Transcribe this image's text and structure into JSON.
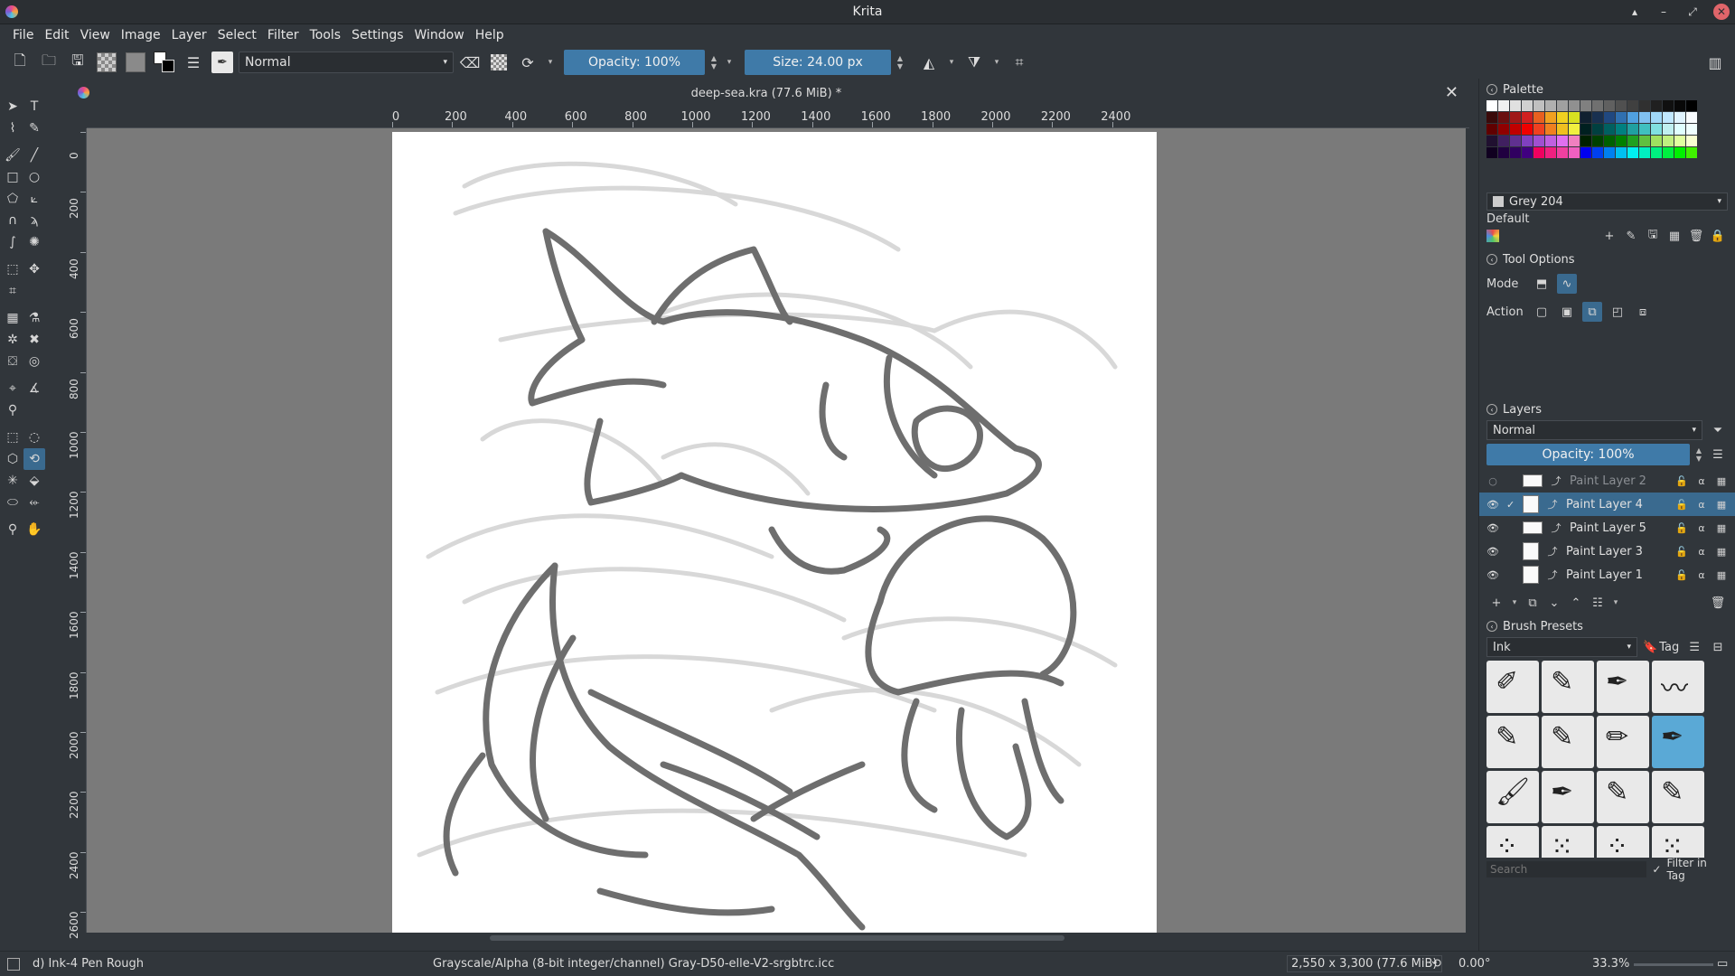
{
  "window": {
    "title": "Krita",
    "controls": [
      "▴",
      "–",
      "⤢",
      "✕"
    ]
  },
  "menu": [
    "File",
    "Edit",
    "View",
    "Image",
    "Layer",
    "Select",
    "Filter",
    "Tools",
    "Settings",
    "Window",
    "Help"
  ],
  "toolbar": {
    "blend_mode": "Normal",
    "opacity": "Opacity: 100%",
    "size": "Size: 24.00 px"
  },
  "document": {
    "title": "deep-sea.kra (77.6 MiB) *"
  },
  "ruler": {
    "top": [
      "0",
      "200",
      "400",
      "600",
      "800",
      "1000",
      "1200",
      "1400",
      "1600",
      "1800",
      "2000",
      "2200",
      "2400"
    ],
    "left": [
      "0",
      "200",
      "400",
      "600",
      "800",
      "1000",
      "1200",
      "1400",
      "1600",
      "1800",
      "2000",
      "2200",
      "2400",
      "2600"
    ]
  },
  "palette": {
    "header": "Palette",
    "current_color": "Grey 204",
    "palette_name": "Default"
  },
  "tool_options": {
    "header": "Tool Options",
    "mode_label": "Mode",
    "action_label": "Action"
  },
  "layers": {
    "header": "Layers",
    "blend_mode": "Normal",
    "opacity": "Opacity:  100%",
    "items": [
      {
        "name": "Paint Layer 2",
        "visible": false,
        "selected": false
      },
      {
        "name": "Paint Layer 4",
        "visible": true,
        "selected": true
      },
      {
        "name": "Paint Layer 5",
        "visible": true,
        "selected": false
      },
      {
        "name": "Paint Layer 3",
        "visible": true,
        "selected": false
      },
      {
        "name": "Paint Layer 1",
        "visible": true,
        "selected": false
      }
    ]
  },
  "brush_presets": {
    "header": "Brush Presets",
    "tag": "Ink",
    "tag_button": "Tag",
    "search_placeholder": "Search",
    "filter_label": "Filter in Tag"
  },
  "status": {
    "brush": "d) Ink-4 Pen Rough",
    "color_space": "Grayscale/Alpha (8-bit integer/channel)  Gray-D50-elle-V2-srgbtrc.icc",
    "dimensions": "2,550 x 3,300 (77.6 MiB)",
    "rotation": "0.00°",
    "zoom": "33.3%"
  },
  "colors": {
    "accent": "#3f7aa8",
    "selection": "#3a6a8f",
    "background": "#31363b",
    "canvas": "#7a7a7a"
  }
}
